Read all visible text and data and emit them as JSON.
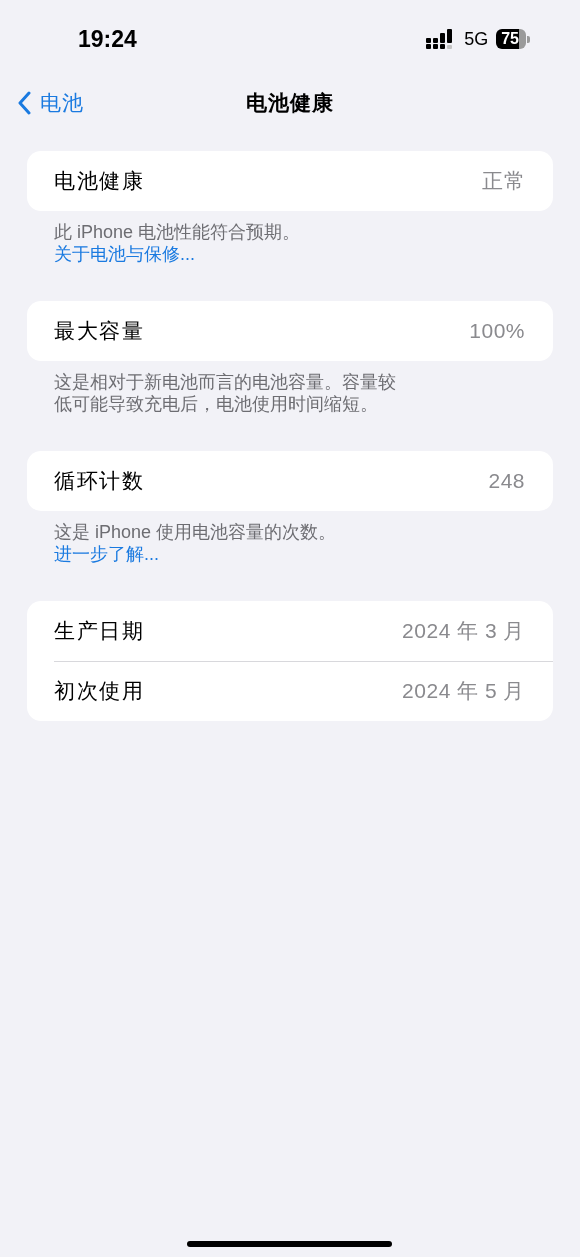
{
  "status_bar": {
    "time": "19:24",
    "network": "5G",
    "battery": "75"
  },
  "nav": {
    "back": "电池",
    "title": "电池健康"
  },
  "sections": [
    {
      "rows": [
        {
          "label": "电池健康",
          "value": "正常"
        }
      ],
      "footer": {
        "text": "此 iPhone 电池性能符合预期。",
        "link": "关于电池与保修..."
      }
    },
    {
      "rows": [
        {
          "label": "最大容量",
          "value": "100%"
        }
      ],
      "footer": {
        "text": "这是相对于新电池而言的电池容量。容量较低可能导致充电后，电池使用时间缩短。"
      }
    },
    {
      "rows": [
        {
          "label": "循环计数",
          "value": "248"
        }
      ],
      "footer": {
        "text": "这是 iPhone 使用电池容量的次数。 ",
        "link": "进一步了解..."
      }
    },
    {
      "rows": [
        {
          "label": "生产日期",
          "value": "2024 年 3 月"
        },
        {
          "label": "初次使用",
          "value": "2024 年 5 月"
        }
      ]
    }
  ]
}
